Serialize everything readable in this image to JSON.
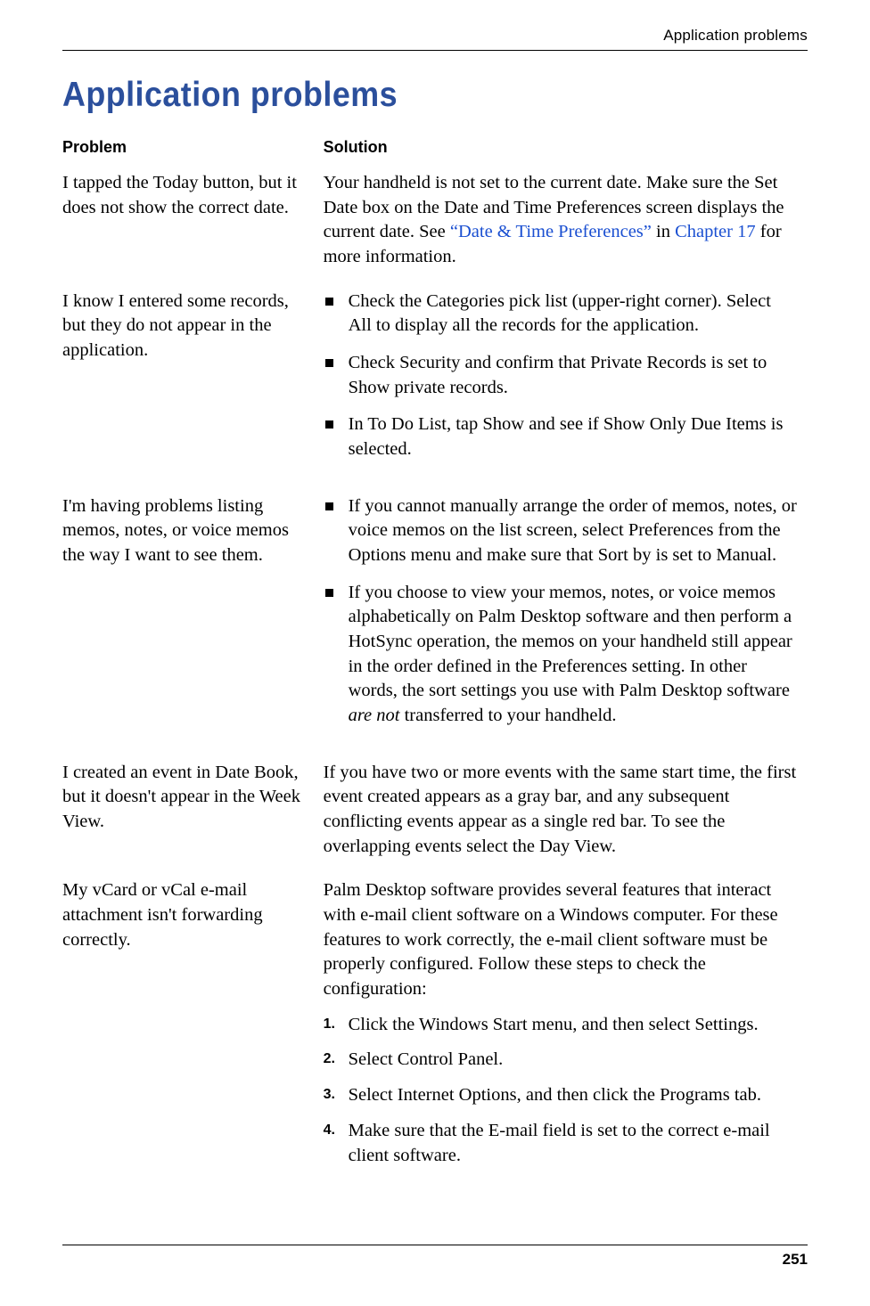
{
  "header": {
    "running_head": "Application problems"
  },
  "section": {
    "title": "Application problems"
  },
  "table": {
    "col_problem": "Problem",
    "col_solution": "Solution",
    "rows": [
      {
        "problem": "I tapped the Today button, but it does not show the correct date.",
        "solution": {
          "pre": "Your handheld is not set to the current date. Make sure the Set Date box on the Date and Time Preferences screen displays the current date. See ",
          "link1": "“Date & Time Preferences”",
          "mid": " in ",
          "link2": "Chapter 17",
          "post": " for more information."
        }
      },
      {
        "problem": "I know I entered some records, but they do not appear in the application.",
        "bullets": [
          "Check the Categories pick list (upper-right corner). Select All to display all the records for the application.",
          "Check Security and confirm that Private Records is set to Show private records.",
          "In To Do List, tap Show and see if Show Only Due Items is selected."
        ]
      },
      {
        "problem": "I'm having problems listing memos, notes, or voice memos the way I want to see them.",
        "bullets_complex": [
          "If you cannot manually arrange the order of memos, notes, or voice memos on the list screen, select Preferences from the Options menu and make sure that Sort by is set to Manual.",
          {
            "pre": "If you choose to view your memos, notes, or voice memos alphabetically on Palm Desktop software and then perform a HotSync operation, the memos on your handheld still appear in the order defined in the Preferences setting. In other words, the sort settings you use with Palm Desktop software ",
            "em": "are not",
            "post": " transferred to your handheld."
          }
        ]
      },
      {
        "problem": "I created an event in Date Book, but it doesn't appear in the Week View.",
        "solution_plain": "If you have two or more events with the same start time, the first event created appears as a gray bar, and any subsequent conflicting events appear as a single red bar. To see the overlapping events select the Day View."
      },
      {
        "problem": "My vCard or vCal e-mail attachment isn't forwarding correctly.",
        "solution_intro": "Palm Desktop software provides several features that interact with e-mail client software on a Windows computer. For these features to work correctly, the e-mail client software must be properly configured. Follow these steps to check the configuration:",
        "steps": [
          "Click the Windows Start menu, and then select Settings.",
          "Select Control Panel.",
          "Select Internet Options, and then click the Programs tab.",
          "Make sure that the E-mail field is set to the correct e-mail client software."
        ]
      }
    ]
  },
  "footer": {
    "page_number": "251"
  }
}
